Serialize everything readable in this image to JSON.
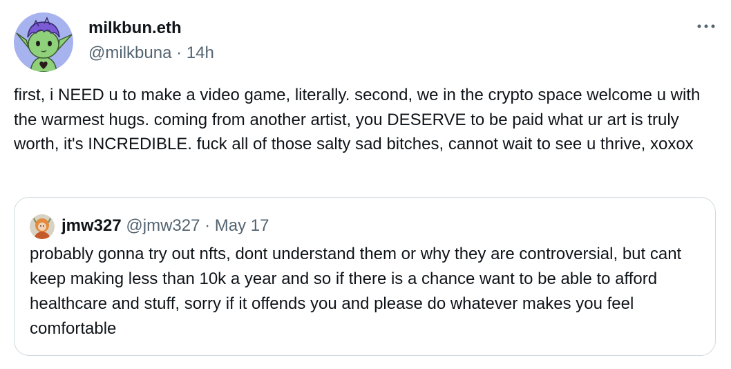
{
  "tweet": {
    "author": {
      "name": "milkbun.eth",
      "handle": "@milkbuna",
      "separator": "·",
      "time": "14h"
    },
    "text": "first, i NEED u to make a video game, literally. second, we in the crypto space welcome u with the warmest hugs. coming from another artist, you DESERVE to be paid what ur art is truly worth, it's INCREDIBLE. fuck all of those salty sad bitches, cannot wait to see u thrive, xoxox",
    "more_icon": "more-horizontal-icon"
  },
  "quote": {
    "author": {
      "name": "jmw327",
      "handle": "@jmw327",
      "separator": "·",
      "date": "May 17"
    },
    "text": "probably gonna try out nfts, dont understand them or why they are controversial, but cant keep making less than 10k a year and so if there is a chance want to be able to afford healthcare and stuff, sorry if it offends you and please do whatever makes you feel comfortable"
  },
  "colors": {
    "primary_text": "#0f1419",
    "secondary_text": "#536471",
    "border": "#cfd9de",
    "avatar_bg": "#a7b3ef",
    "avatar_skin": "#8fd07a"
  }
}
